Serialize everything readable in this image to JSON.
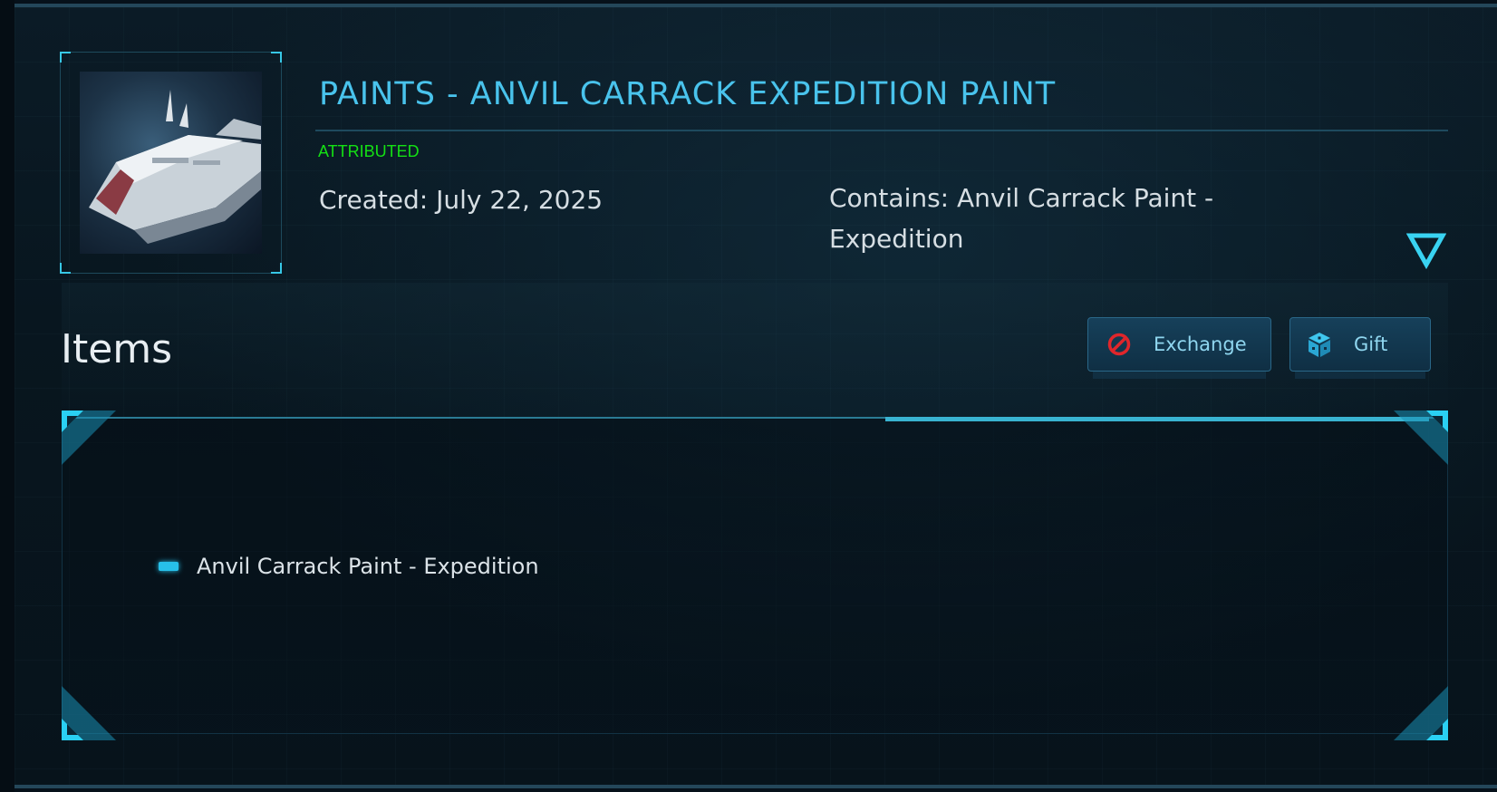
{
  "pledge": {
    "title": "PAINTS - ANVIL CARRACK EXPEDITION PAINT",
    "status": "ATTRIBUTED",
    "created": "Created: July 22, 2025",
    "contains": "Contains: Anvil Carrack Paint - Expedition",
    "thumbnail_icon": "ship-thumbnail"
  },
  "items_section": {
    "heading": "Items",
    "actions": {
      "exchange_label": "Exchange",
      "gift_label": "Gift"
    },
    "items": [
      {
        "label": "Anvil Carrack Paint - Expedition"
      }
    ]
  },
  "colors": {
    "accent": "#49c3ec",
    "status_green": "#14e014",
    "background": "#07131b",
    "exchange_icon_red": "#e0262b"
  },
  "icons": {
    "expand": "triangle-down-icon",
    "exchange": "no-entry-icon",
    "gift": "gift-box-icon",
    "item": "dash-bullet-icon"
  }
}
